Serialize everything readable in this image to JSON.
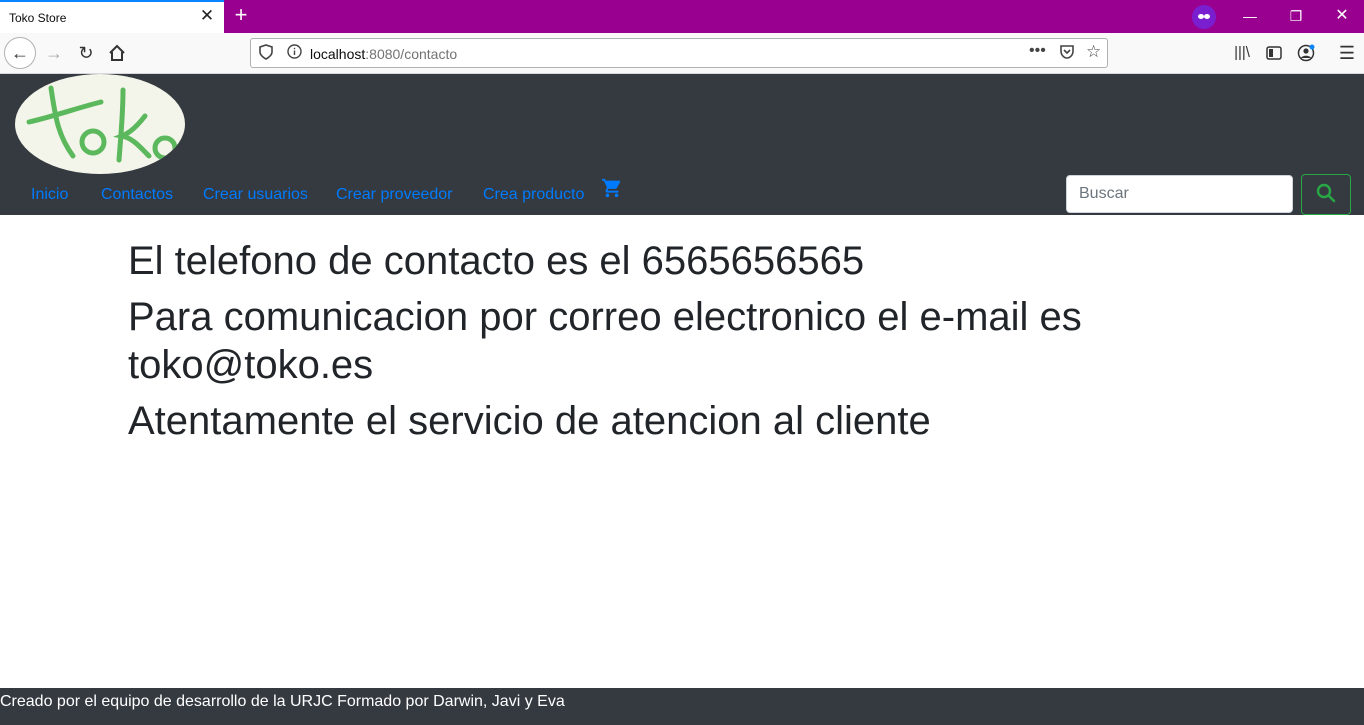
{
  "browser": {
    "tab_title": "Toko Store",
    "url_host": "localhost",
    "url_path": ":8080/contacto"
  },
  "header": {
    "logo_text": "Toko",
    "nav": [
      "Inicio",
      "Contactos",
      "Crear usuarios",
      "Crear proveedor",
      "Crea producto"
    ],
    "search_placeholder": "Buscar"
  },
  "content": {
    "phone_line": "El telefono de contacto es el 6565656565",
    "email_line": "Para comunicacion por correo electronico el e-mail es toko@toko.es",
    "closing_line": "Atentamente el servicio de atencion al cliente"
  },
  "footer": {
    "text": "Creado por el equipo de desarrollo de la URJC Formado por Darwin, Javi y Eva"
  },
  "colors": {
    "tabbar": "#99008f",
    "header": "#343a40",
    "link": "#007bff",
    "search_button": "#28a745"
  }
}
